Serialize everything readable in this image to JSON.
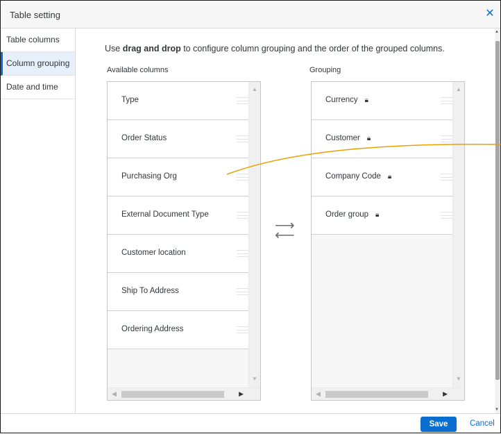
{
  "dialog": {
    "title": "Table setting",
    "close_icon": "close-icon"
  },
  "sidebar": {
    "items": [
      {
        "label": "Table columns",
        "active": false
      },
      {
        "label": "Column grouping",
        "active": true
      },
      {
        "label": "Date and time",
        "active": false
      }
    ]
  },
  "main": {
    "instruction_prefix": "Use ",
    "instruction_bold": "drag and drop",
    "instruction_suffix": " to configure column grouping and the order of the grouped columns.",
    "available_label": "Available columns",
    "grouping_label": "Grouping",
    "available_columns": [
      "Type",
      "Order Status",
      "Purchasing Org",
      "External Document Type",
      "Customer location",
      "Ship To Address",
      "Ordering Address"
    ],
    "grouping_columns": [
      "Currency",
      "Customer",
      "Company Code",
      "Order group"
    ],
    "lock_icon": "lock-icon",
    "swap_icon": "swap-arrows-icon"
  },
  "footer": {
    "save_label": "Save",
    "cancel_label": "Cancel"
  },
  "colors": {
    "accent": "#0a6ed1",
    "drag_indicator": "#e8a100"
  }
}
